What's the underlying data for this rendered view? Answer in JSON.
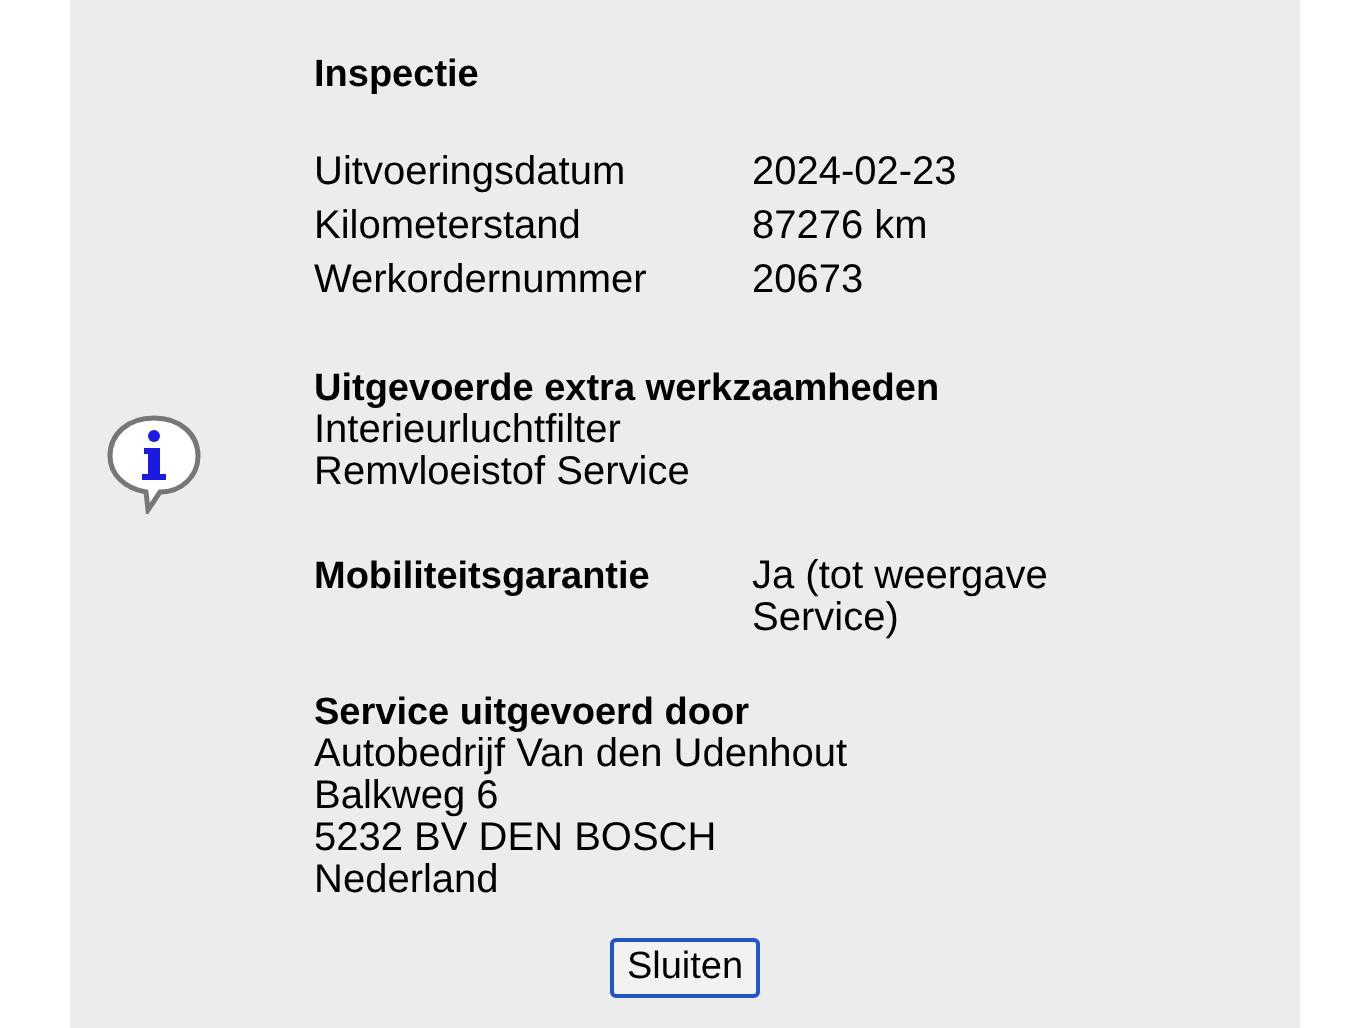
{
  "title": "Inspectie",
  "details": [
    {
      "label": "Uitvoeringsdatum",
      "value": "2024-02-23"
    },
    {
      "label": "Kilometerstand",
      "value": "87276 km"
    },
    {
      "label": "Werkordernummer",
      "value": "20673"
    }
  ],
  "extra_work": {
    "heading": "Uitgevoerde extra werkzaamheden",
    "items": [
      "Interieurluchtfilter",
      "Remvloeistof Service"
    ]
  },
  "mobility": {
    "label": "Mobiliteitsgarantie",
    "value": "Ja (tot weergave Service)"
  },
  "service_by": {
    "heading": "Service uitgevoerd door",
    "lines": [
      "Autobedrijf Van den Udenhout",
      "Balkweg 6",
      "5232 BV DEN BOSCH",
      "Nederland"
    ]
  },
  "buttons": [
    {
      "label": "Sluiten",
      "focused": true
    }
  ]
}
